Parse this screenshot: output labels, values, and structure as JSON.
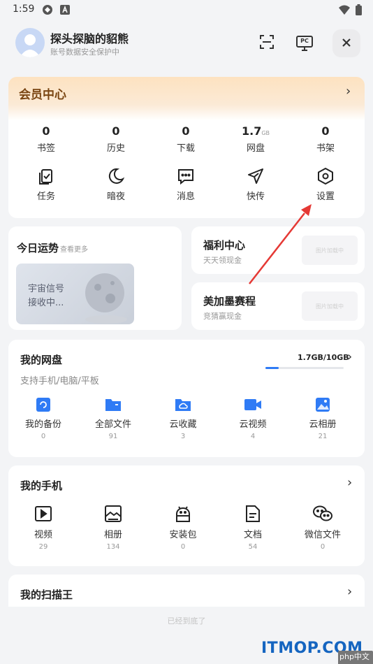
{
  "status_bar": {
    "time": "1:59"
  },
  "header": {
    "username": "探头探脑的貂熊",
    "subtitle": "账号数据安全保护中",
    "pc_label": "PC"
  },
  "member": {
    "title": "会员中心",
    "stats": [
      {
        "value": "0",
        "unit": "",
        "label": "书签"
      },
      {
        "value": "0",
        "unit": "",
        "label": "历史"
      },
      {
        "value": "0",
        "unit": "",
        "label": "下载"
      },
      {
        "value": "1.7",
        "unit": "GB",
        "label": "网盘"
      },
      {
        "value": "0",
        "unit": "",
        "label": "书架"
      }
    ],
    "tools": [
      {
        "label": "任务",
        "icon": "task-icon"
      },
      {
        "label": "暗夜",
        "icon": "moon-icon"
      },
      {
        "label": "消息",
        "icon": "message-icon"
      },
      {
        "label": "快传",
        "icon": "paper-plane-icon"
      },
      {
        "label": "设置",
        "icon": "settings-icon"
      }
    ]
  },
  "fortune": {
    "title": "今日运势",
    "more": "查看更多",
    "lines": [
      "宇宙信号",
      "接收中..."
    ]
  },
  "welfare": {
    "title": "福利中心",
    "subtitle": "天天领现金",
    "placeholder": "图片加载中"
  },
  "contest": {
    "title": "美加墨赛程",
    "subtitle": "竞猜赢现金",
    "placeholder": "图片加载中"
  },
  "cloud_disk": {
    "title": "我的网盘",
    "subtitle": "支持手机/电脑/平板",
    "usage": "1.7GB/10GB",
    "usage_fraction": 0.17,
    "items": [
      {
        "label": "我的备份",
        "count": "0",
        "icon": "backup-icon"
      },
      {
        "label": "全部文件",
        "count": "91",
        "icon": "folder-icon"
      },
      {
        "label": "云收藏",
        "count": "3",
        "icon": "cloud-folder-icon"
      },
      {
        "label": "云视频",
        "count": "4",
        "icon": "video-camera-icon"
      },
      {
        "label": "云相册",
        "count": "21",
        "icon": "photo-icon"
      }
    ]
  },
  "my_phone": {
    "title": "我的手机",
    "items": [
      {
        "label": "视频",
        "count": "29",
        "icon": "play-icon"
      },
      {
        "label": "相册",
        "count": "134",
        "icon": "album-icon"
      },
      {
        "label": "安装包",
        "count": "0",
        "icon": "android-icon"
      },
      {
        "label": "文档",
        "count": "54",
        "icon": "document-icon"
      },
      {
        "label": "微信文件",
        "count": "0",
        "icon": "wechat-icon"
      }
    ]
  },
  "scanner": {
    "title": "我的扫描王"
  },
  "end_text": "已经到底了",
  "watermark": {
    "text": "ITMOP.COM",
    "badge": "php中文网"
  },
  "colors": {
    "accent_blue": "#2f7bf5",
    "member_gold": "#7a4613",
    "arrow_red": "#e53935"
  }
}
